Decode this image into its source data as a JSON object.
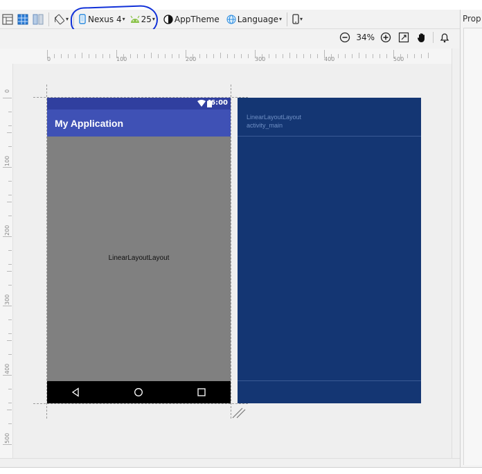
{
  "toolbar": {
    "device_label": "Nexus 4",
    "api_label": "25",
    "theme_label": "AppTheme",
    "language_label": "Language"
  },
  "zoom": {
    "level_label": "34%"
  },
  "properties_panel": {
    "title": "Prop"
  },
  "ruler": {
    "horizontal_labels": [
      "0",
      "100",
      "200",
      "300",
      "400",
      "500"
    ],
    "vertical_labels": [
      "0",
      "100",
      "200",
      "300",
      "400",
      "500"
    ]
  },
  "device_preview": {
    "status_time": "6:00",
    "app_title": "My Application",
    "layout_label": "LinearLayoutLayout"
  },
  "blueprint": {
    "layout_label": "LinearLayoutLayout",
    "file_label": "activity_main"
  },
  "colors": {
    "primary": "#3f51b5",
    "primary_dark": "#303f9f",
    "blueprint_bg": "#143673",
    "annotation": "#1030d8"
  }
}
